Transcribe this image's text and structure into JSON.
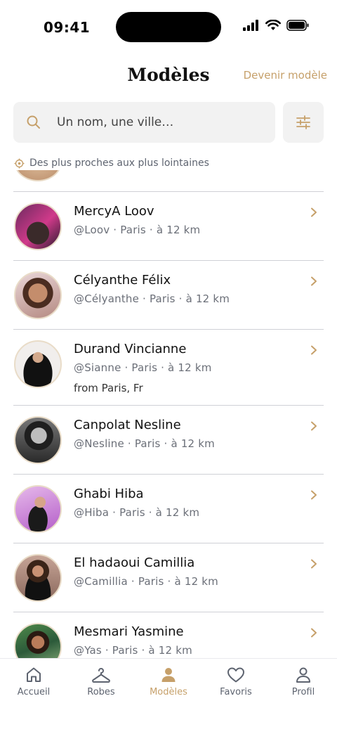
{
  "status_bar": {
    "time": "09:41"
  },
  "header": {
    "title": "Modèles",
    "action_label": "Devenir modèle"
  },
  "search": {
    "placeholder": "Un nom, une ville…"
  },
  "sort": {
    "label": "Des plus proches aux plus lointaines"
  },
  "models": [
    {
      "name": "MercyA Loov",
      "meta": "@Loov · Paris · à 12 km",
      "extra": ""
    },
    {
      "name": "Célyanthe Félix",
      "meta": "@Célyanthe · Paris · à 12 km",
      "extra": ""
    },
    {
      "name": "Durand Vincianne",
      "meta": "@Sianne · Paris · à 12 km",
      "extra": "from Paris, Fr"
    },
    {
      "name": "Canpolat Nesline",
      "meta": "@Nesline · Paris · à 12 km",
      "extra": ""
    },
    {
      "name": "Ghabi Hiba",
      "meta": "@Hiba · Paris · à 12 km",
      "extra": ""
    },
    {
      "name": "El hadaoui Camillia",
      "meta": "@Camillia · Paris · à 12 km",
      "extra": ""
    },
    {
      "name": "Mesmari Yasmine",
      "meta": "@Yas · Paris · à 12 km",
      "extra": ""
    }
  ],
  "tabs": [
    {
      "label": "Accueil",
      "icon": "home-icon",
      "active": false
    },
    {
      "label": "Robes",
      "icon": "hanger-icon",
      "active": false
    },
    {
      "label": "Modèles",
      "icon": "person-icon",
      "active": true
    },
    {
      "label": "Favoris",
      "icon": "heart-icon",
      "active": false
    },
    {
      "label": "Profil",
      "icon": "profile-icon",
      "active": false
    }
  ],
  "colors": {
    "accent": "#c6a06a",
    "muted": "#5e6470",
    "divider": "#cfd0d6",
    "field_bg": "#f2f2f2"
  }
}
